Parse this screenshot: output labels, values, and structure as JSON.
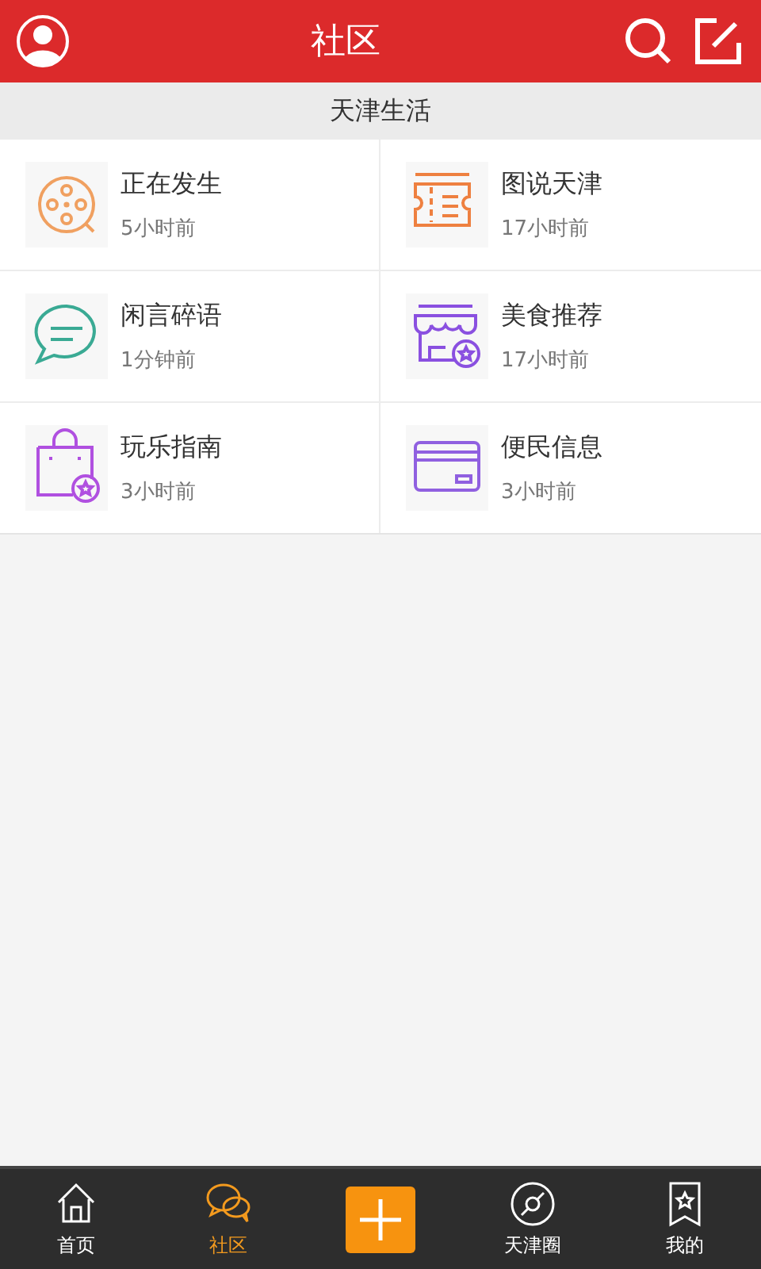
{
  "header": {
    "title": "社区"
  },
  "section": {
    "title": "天津生活"
  },
  "channels": [
    {
      "name": "正在发生",
      "time": "5小时前"
    },
    {
      "name": "图说天津",
      "time": "17小时前"
    },
    {
      "name": "闲言碎语",
      "time": "1分钟前"
    },
    {
      "name": "美食推荐",
      "time": "17小时前"
    },
    {
      "name": "玩乐指南",
      "time": "3小时前"
    },
    {
      "name": "便民信息",
      "time": "3小时前"
    }
  ],
  "tab_bar": [
    {
      "kind": "tab",
      "label": "首页",
      "selected": false
    },
    {
      "kind": "tab",
      "label": "社区",
      "selected": true
    },
    {
      "kind": "add"
    },
    {
      "kind": "tab",
      "label": "天津圈",
      "selected": false
    },
    {
      "kind": "tab",
      "label": "我的",
      "selected": false
    }
  ]
}
